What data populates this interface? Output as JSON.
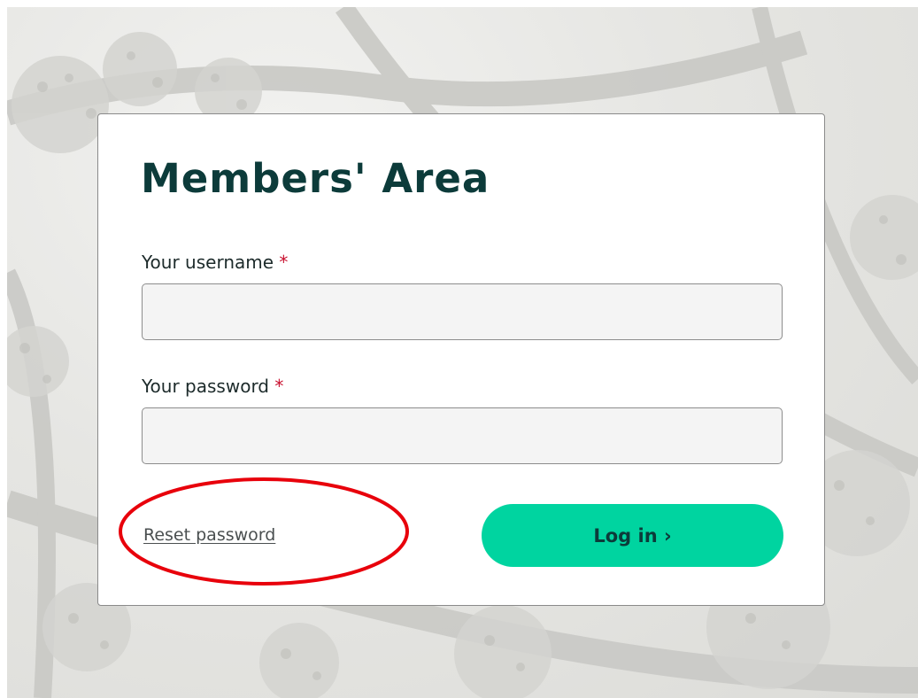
{
  "login_form": {
    "title": "Members' Area",
    "username_label": "Your username",
    "password_label": "Your password",
    "required_marker": "*",
    "username_value": "",
    "password_value": "",
    "reset_link": "Reset password",
    "login_button": "Log in ›"
  },
  "colors": {
    "title": "#0c3b3a",
    "required": "#c8102e",
    "button": "#00d4a0",
    "annotation": "#e8000b"
  }
}
